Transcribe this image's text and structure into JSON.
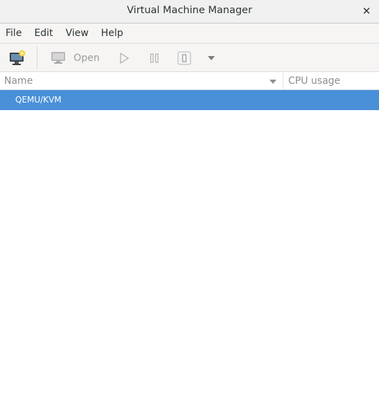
{
  "window": {
    "title": "Virtual Machine Manager",
    "close_glyph": "✕"
  },
  "menubar": {
    "items": [
      "File",
      "Edit",
      "View",
      "Help"
    ]
  },
  "toolbar": {
    "new_vm_icon": "new-vm-icon",
    "open_label": "Open",
    "open_enabled": false,
    "run_enabled": false,
    "pause_enabled": false,
    "shutdown_enabled": false
  },
  "table": {
    "columns": [
      "Name",
      "CPU usage"
    ],
    "rows": [
      {
        "name": "QEMU/KVM",
        "cpu": "",
        "selected": true
      }
    ]
  },
  "colors": {
    "selection": "#4a90d9",
    "disabled_text": "#9a9a9a"
  }
}
